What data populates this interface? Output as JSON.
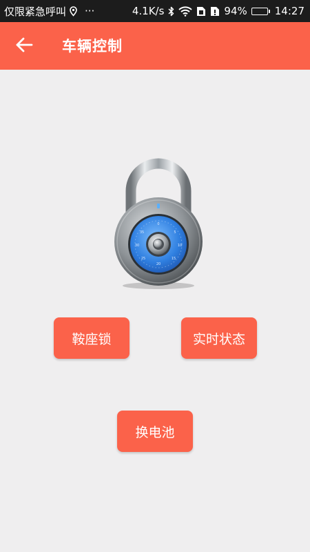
{
  "status_bar": {
    "carrier": "仅限紧急呼叫",
    "more": "···",
    "speed": "4.1K/s",
    "battery_percent": "94%",
    "battery_level": 0.94,
    "time": "14:27",
    "icons": [
      "location-icon",
      "bluetooth-icon",
      "wifi-icon",
      "sim1-icon",
      "sim2-icon",
      "battery-icon"
    ]
  },
  "app_bar": {
    "title": "车辆控制",
    "back_icon": "arrow-left-icon"
  },
  "illustration": {
    "icon": "padlock-icon"
  },
  "buttons": {
    "seat_lock": "鞍座锁",
    "realtime_status": "实时状态",
    "swap_battery": "换电池"
  },
  "colors": {
    "accent": "#fb624a",
    "background": "#efeeef",
    "status_bar": "#1c1c1c"
  }
}
